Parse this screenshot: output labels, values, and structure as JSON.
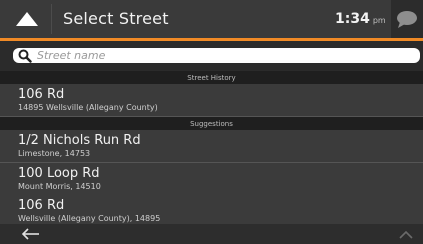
{
  "header": {
    "title": "Select Street",
    "time": "1:34",
    "ampm": "pm"
  },
  "search": {
    "placeholder": "Street name",
    "value": ""
  },
  "sections": {
    "history_label": "Street History",
    "suggestions_label": "Suggestions"
  },
  "history": [
    {
      "name": "106 Rd",
      "sub": "14895 Wellsville (Allegany County)"
    }
  ],
  "suggestions": [
    {
      "name": "1/2 Nichols Run Rd",
      "sub": "Limestone, 14753"
    },
    {
      "name": "100 Loop Rd",
      "sub": "Mount Morris, 14510"
    },
    {
      "name": "106 Rd",
      "sub": "Wellsville (Allegany County), 14895"
    }
  ],
  "colors": {
    "accent": "#f08a26",
    "header_bg": "#3a3a3a",
    "row_bg": "#3b3b3b"
  },
  "icons": {
    "back": "triangle-up-icon",
    "search": "search-icon",
    "chat": "chat-bubble-icon",
    "nav_back": "arrow-left-icon",
    "scroll_up": "chevron-up-icon"
  }
}
